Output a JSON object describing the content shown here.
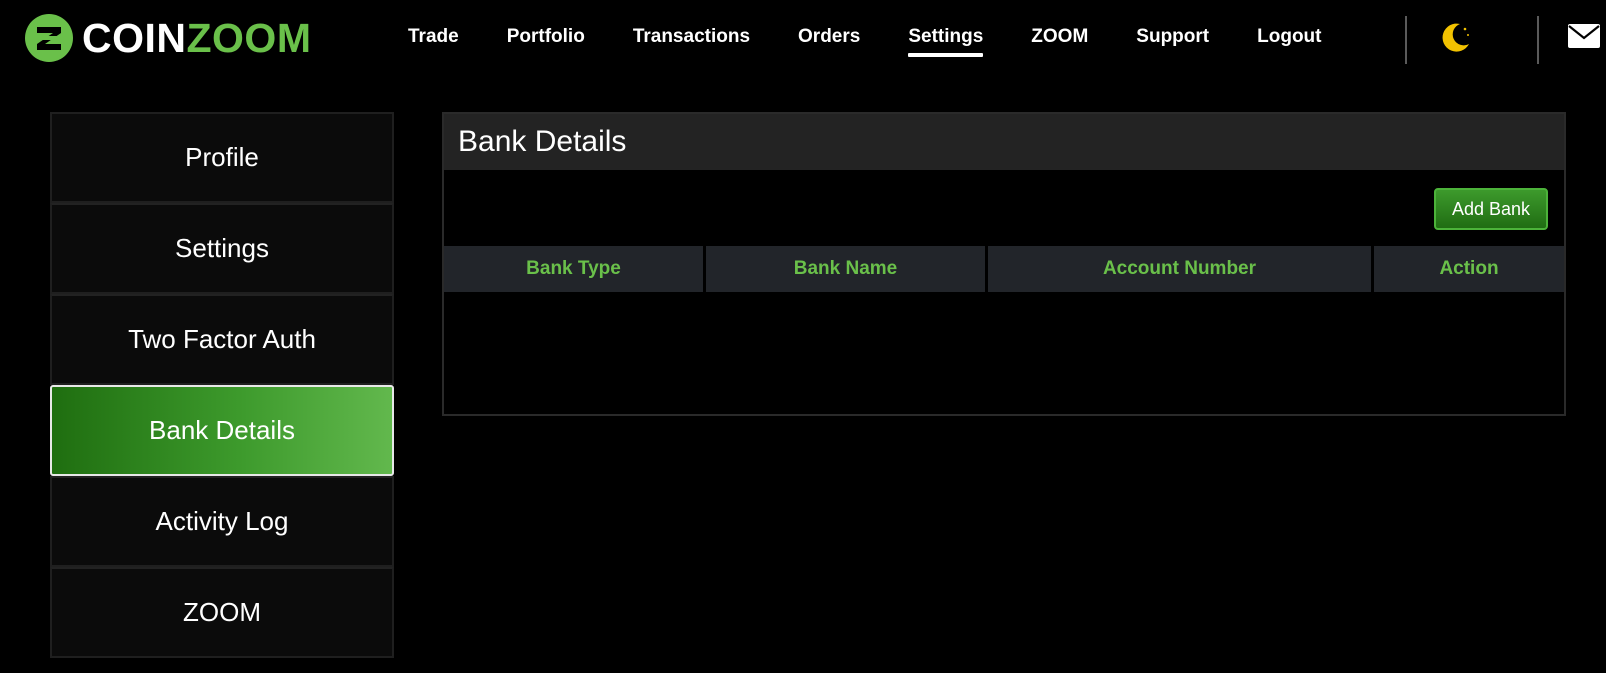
{
  "brand": {
    "name_white": "COIN",
    "name_green": "ZOOM",
    "mark_letter": "Z"
  },
  "colors": {
    "accent": "#6ac04a",
    "header_bg": "#232323",
    "table_head_bg": "#22252a",
    "moon": "#f2c200"
  },
  "nav": {
    "items": [
      {
        "label": "Trade",
        "active": false
      },
      {
        "label": "Portfolio",
        "active": false
      },
      {
        "label": "Transactions",
        "active": false
      },
      {
        "label": "Orders",
        "active": false
      },
      {
        "label": "Settings",
        "active": true
      },
      {
        "label": "ZOOM",
        "active": false
      },
      {
        "label": "Support",
        "active": false
      },
      {
        "label": "Logout",
        "active": false
      }
    ],
    "icons": {
      "theme": "moon-icon",
      "mail": "mail-icon"
    }
  },
  "sidebar": {
    "items": [
      {
        "label": "Profile",
        "active": false
      },
      {
        "label": "Settings",
        "active": false
      },
      {
        "label": "Two Factor Auth",
        "active": false
      },
      {
        "label": "Bank Details",
        "active": true
      },
      {
        "label": "Activity Log",
        "active": false
      },
      {
        "label": "ZOOM",
        "active": false
      }
    ]
  },
  "bank": {
    "title": "Bank Details",
    "add_button": "Add Bank",
    "columns": [
      "Bank Type",
      "Bank Name",
      "Account Number",
      "Action"
    ],
    "rows": []
  }
}
